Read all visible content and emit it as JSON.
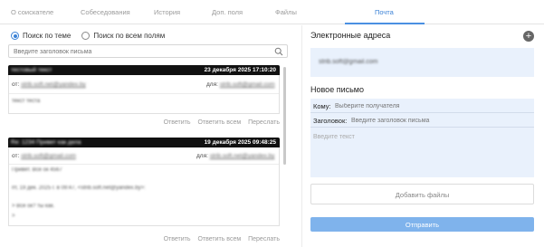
{
  "tabs": [
    {
      "label": "О соискателе"
    },
    {
      "label": "Собеседования"
    },
    {
      "label": "История"
    },
    {
      "label": "Доп. поля"
    },
    {
      "label": "Файлы"
    },
    {
      "label": "Почта",
      "active": true
    }
  ],
  "search": {
    "options": [
      {
        "label": "Поиск по теме",
        "checked": true
      },
      {
        "label": "Поиск по всем полям",
        "checked": false
      }
    ],
    "placeholder": "Введите заголовок письма"
  },
  "messages": [
    {
      "subject": "тестовый текст",
      "date": "23 декабря 2025 17:10:20",
      "from_label": "от:",
      "from": "strib.soft.net@yandex.by",
      "to_label": "для:",
      "to": "strib.soft@gmail.com",
      "body_lines": [
        "текст теста"
      ]
    },
    {
      "subject": "Re: 1234 Привет как дела",
      "date": "19 декабря 2025 09:48:25",
      "from_label": "от:",
      "from": "strib.soft@gmail.com",
      "to_label": "для:",
      "to": "strib.soft.net@yandex.by",
      "body_lines": [
        "Привет. Все ок 4567",
        "пт, 19 дек. 2025 г. в 09:47, <strib.soft.net@yandex.by>:",
        "> Все ок? ты как.",
        ">"
      ]
    }
  ],
  "actions": {
    "reply": "Ответить",
    "reply_all": "Ответить всем",
    "forward": "Переслать"
  },
  "right": {
    "emails_title": "Электронные адреса",
    "add_icon": "plus-icon",
    "emails": [
      "strib.soft@gmail.com"
    ],
    "new_letter_title": "Новое письмо",
    "to_label": "Кому:",
    "to_placeholder": "Выберите получателя",
    "subject_label": "Заголовок:",
    "subject_placeholder": "Введите заголовок письма",
    "body_placeholder": "Введите текст",
    "attach_label": "Добавить файлы",
    "send_label": "Отправить"
  },
  "colors": {
    "accent": "#4a90e2",
    "send_button": "#7fb3ec",
    "panel_bg": "#e9f1fc",
    "message_header": "#111111"
  }
}
